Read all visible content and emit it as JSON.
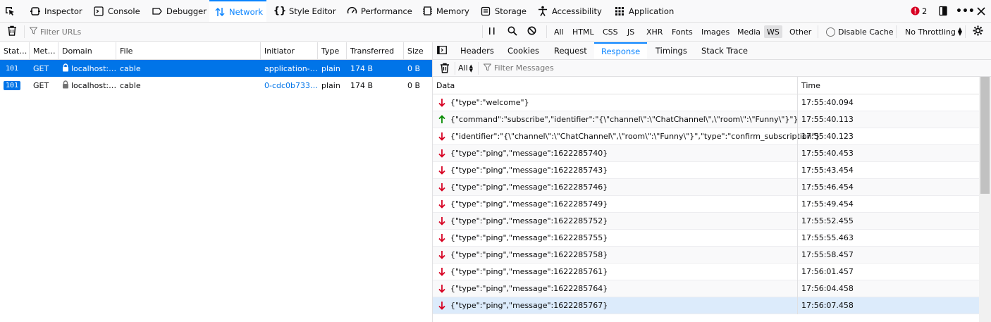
{
  "toolbox": {
    "tabs": [
      {
        "label": "Inspector",
        "icon": "inspector-icon"
      },
      {
        "label": "Console",
        "icon": "console-icon"
      },
      {
        "label": "Debugger",
        "icon": "debugger-icon"
      },
      {
        "label": "Network",
        "icon": "network-icon",
        "active": true
      },
      {
        "label": "Style Editor",
        "icon": "style-editor-icon"
      },
      {
        "label": "Performance",
        "icon": "performance-icon"
      },
      {
        "label": "Memory",
        "icon": "memory-icon"
      },
      {
        "label": "Storage",
        "icon": "storage-icon"
      },
      {
        "label": "Accessibility",
        "icon": "accessibility-icon"
      },
      {
        "label": "Application",
        "icon": "application-icon"
      }
    ],
    "error_count": "2"
  },
  "filterbar": {
    "filter_placeholder": "Filter URLs",
    "types": [
      "All",
      "HTML",
      "CSS",
      "JS",
      "XHR",
      "Fonts",
      "Images",
      "Media",
      "WS",
      "Other"
    ],
    "selected_type": "WS",
    "disable_cache_label": "Disable Cache",
    "throttling_label": "No Throttling"
  },
  "requests": {
    "columns": [
      "Stat…",
      "Met…",
      "Domain",
      "File",
      "Initiator",
      "Type",
      "Transferred",
      "Size"
    ],
    "rows": [
      {
        "status": "101",
        "method": "GET",
        "domain": "localhost:…",
        "file": "cable",
        "initiator": "application-…",
        "type": "plain",
        "transferred": "174 B",
        "size": "0 B",
        "selected": true
      },
      {
        "status": "101",
        "method": "GET",
        "domain": "localhost:…",
        "file": "cable",
        "initiator": "0-cdc0b733…",
        "type": "plain",
        "transferred": "174 B",
        "size": "0 B",
        "selected": false
      }
    ]
  },
  "detail": {
    "tabs": [
      "Headers",
      "Cookies",
      "Request",
      "Response",
      "Timings",
      "Stack Trace"
    ],
    "active_tab": "Response",
    "message_filter_select": "All",
    "message_filter_placeholder": "Filter Messages",
    "columns": [
      "Data",
      "Time"
    ],
    "messages": [
      {
        "dir": "in",
        "data": "{\"type\":\"welcome\"}",
        "time": "17:55:40.094"
      },
      {
        "dir": "out",
        "data": "{\"command\":\"subscribe\",\"identifier\":\"{\\\"channel\\\":\\\"ChatChannel\\\",\\\"room\\\":\\\"Funny\\\"}\"}",
        "time": "17:55:40.113"
      },
      {
        "dir": "in",
        "data": "{\"identifier\":\"{\\\"channel\\\":\\\"ChatChannel\\\",\\\"room\\\":\\\"Funny\\\"}\",\"type\":\"confirm_subscription\"}",
        "time": "17:55:40.123"
      },
      {
        "dir": "in",
        "data": "{\"type\":\"ping\",\"message\":1622285740}",
        "time": "17:55:40.453"
      },
      {
        "dir": "in",
        "data": "{\"type\":\"ping\",\"message\":1622285743}",
        "time": "17:55:43.454"
      },
      {
        "dir": "in",
        "data": "{\"type\":\"ping\",\"message\":1622285746}",
        "time": "17:55:46.454"
      },
      {
        "dir": "in",
        "data": "{\"type\":\"ping\",\"message\":1622285749}",
        "time": "17:55:49.454"
      },
      {
        "dir": "in",
        "data": "{\"type\":\"ping\",\"message\":1622285752}",
        "time": "17:55:52.455"
      },
      {
        "dir": "in",
        "data": "{\"type\":\"ping\",\"message\":1622285755}",
        "time": "17:55:55.463"
      },
      {
        "dir": "in",
        "data": "{\"type\":\"ping\",\"message\":1622285758}",
        "time": "17:55:58.457"
      },
      {
        "dir": "in",
        "data": "{\"type\":\"ping\",\"message\":1622285761}",
        "time": "17:56:01.457"
      },
      {
        "dir": "in",
        "data": "{\"type\":\"ping\",\"message\":1622285764}",
        "time": "17:56:04.458"
      },
      {
        "dir": "in",
        "data": "{\"type\":\"ping\",\"message\":1622285767}",
        "time": "17:56:07.458",
        "selected": true
      }
    ]
  },
  "colors": {
    "accent": "#0a84ff",
    "selected_row": "#0074e8",
    "incoming": "#d70022",
    "outgoing": "#058b00",
    "error": "#d70022"
  }
}
